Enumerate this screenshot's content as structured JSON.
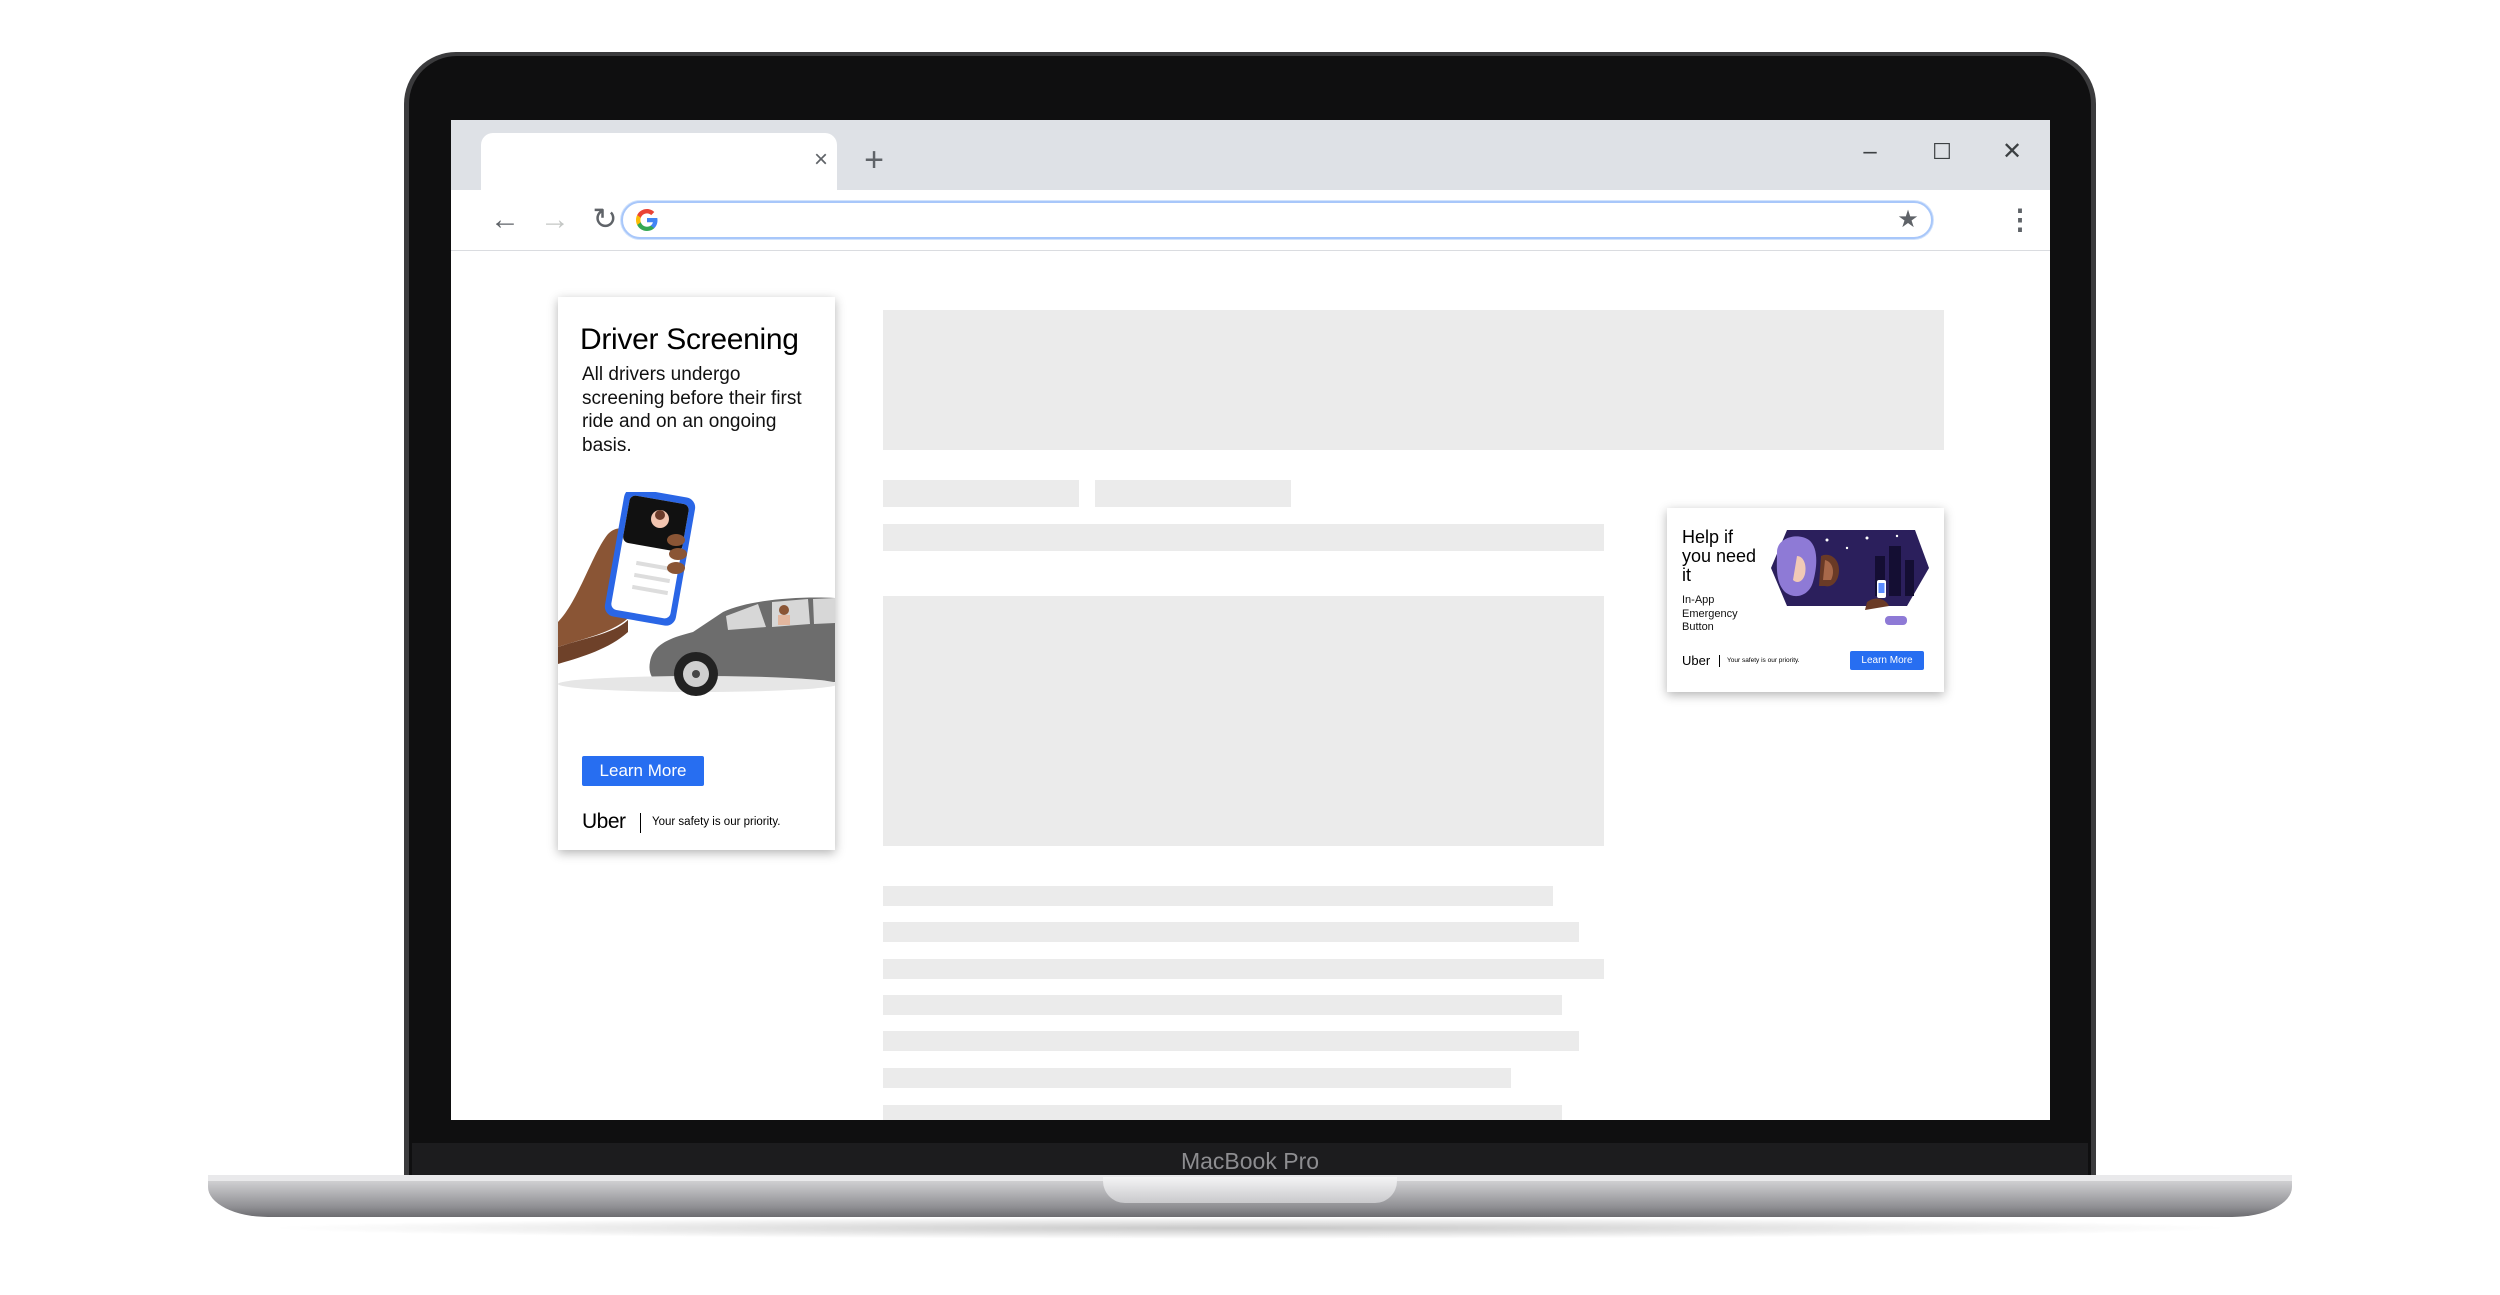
{
  "device": {
    "label": "MacBook Pro"
  },
  "browser": {
    "tab": {
      "title": "",
      "close_glyph": "×"
    },
    "new_tab_glyph": "+",
    "window_controls": {
      "minimize": "–",
      "maximize": "☐",
      "close": "✕"
    },
    "nav": {
      "back": "←",
      "forward": "→",
      "reload": "↻"
    },
    "omnibox": {
      "value": "",
      "placeholder": ""
    },
    "bookmark_glyph": "★",
    "menu_glyph": "⋮",
    "search_engine_icon": "google-g-icon"
  },
  "ads": {
    "driver_screening": {
      "title": "Driver Screening",
      "body": "All drivers undergo screening before their first ride and on an ongoing basis.",
      "cta": "Learn More",
      "brand": "Uber",
      "tagline": "Your safety is our priority."
    },
    "help": {
      "title": "Help if you need it",
      "subtitle": "In-App Emergency Button",
      "brand": "Uber",
      "tagline": "Your safety is our priority.",
      "cta": "Learn More"
    }
  },
  "colors": {
    "cta_blue": "#276ef1",
    "tabstrip": "#dee1e6",
    "skeleton": "#ebebeb",
    "bezel": "#0f0f10"
  }
}
